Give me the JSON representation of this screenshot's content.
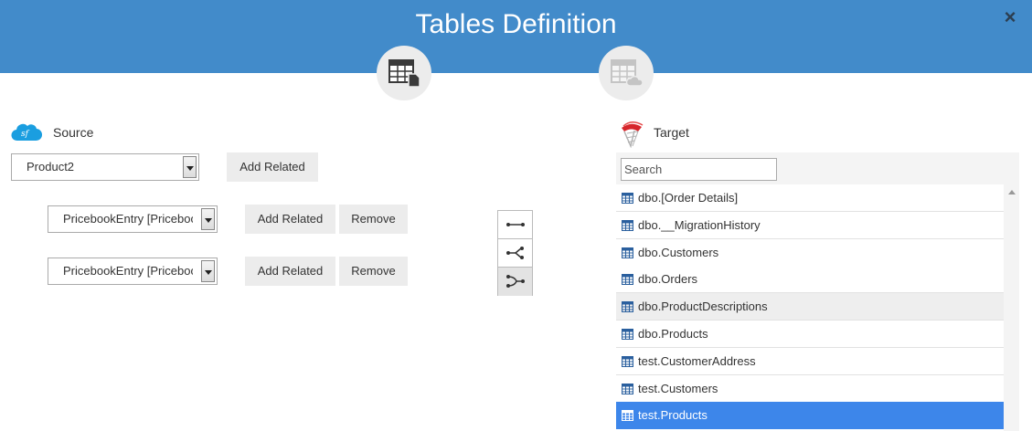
{
  "header": {
    "title": "Tables Definition",
    "close_icon": "×",
    "steps": [
      {
        "icon": "table-file-icon",
        "active": true
      },
      {
        "icon": "table-cloud-icon",
        "active": false
      }
    ]
  },
  "source": {
    "label": "Source",
    "icon": "salesforce-icon",
    "main_select": {
      "value": "Product2",
      "button_label": "Add Related"
    },
    "related": [
      {
        "value": "PricebookEntry [Pricebook",
        "add_label": "Add Related",
        "remove_label": "Remove"
      },
      {
        "value": "PricebookEntry [Pricebook",
        "add_label": "Add Related",
        "remove_label": "Remove"
      }
    ]
  },
  "join_types": [
    {
      "icon": "join-straight-icon",
      "active": false
    },
    {
      "icon": "join-split-icon",
      "active": false
    },
    {
      "icon": "join-merge-icon",
      "active": true
    }
  ],
  "target": {
    "label": "Target",
    "icon": "sql-server-icon",
    "search_placeholder": "Search",
    "tables": [
      {
        "label": "dbo.[Order Details]",
        "state": "normal"
      },
      {
        "label": "dbo.__MigrationHistory",
        "state": "normal"
      },
      {
        "label": "dbo.Customers",
        "state": "normal"
      },
      {
        "label": "dbo.Orders",
        "state": "normal"
      },
      {
        "label": "dbo.ProductDescriptions",
        "state": "hover"
      },
      {
        "label": "dbo.Products",
        "state": "normal"
      },
      {
        "label": "test.CustomerAddress",
        "state": "normal"
      },
      {
        "label": "test.Customers",
        "state": "normal"
      },
      {
        "label": "test.Products",
        "state": "selected"
      }
    ]
  },
  "colors": {
    "header": "#428bca",
    "selected": "#3d86ea",
    "table_icon": "#2a5f9e"
  }
}
